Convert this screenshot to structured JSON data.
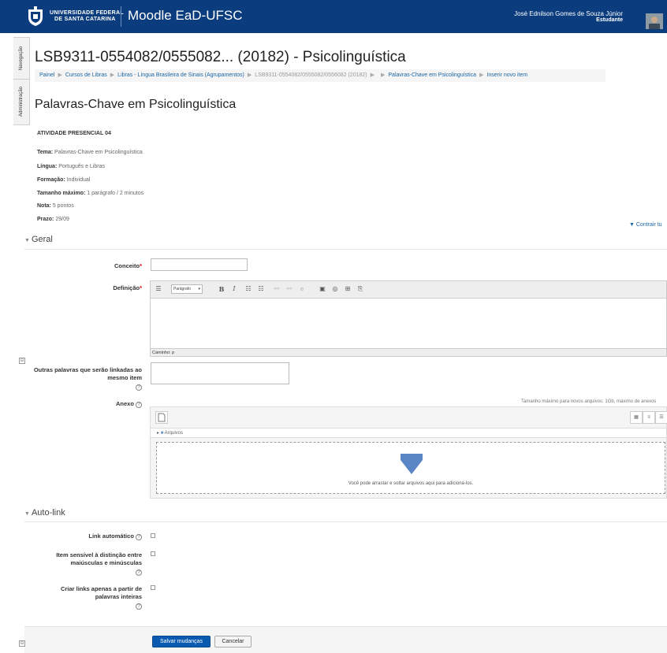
{
  "header": {
    "university": [
      "UNIVERSIDADE FEDERAL",
      "DE SANTA CATARINA"
    ],
    "site_name": "Moodle EaD-UFSC",
    "user_name": "José Ednilson Gomes de Souza Júnior",
    "user_role": "Estudante"
  },
  "dock": {
    "tab1": "Navegação",
    "tab2": "Administração"
  },
  "course_title": "LSB9311-0554082/0555082... (20182) - Psicolinguística",
  "breadcrumb": {
    "items": [
      "Painel",
      "Cursos de Libras",
      "Libras - Língua Brasileira de Sinais (Agrupamentos)",
      "LSB9311-0554082/0555082/0556082 (20182)",
      "",
      "Palavras-Chave em Psicolinguística",
      "Inserir novo item"
    ]
  },
  "page_title": "Palavras-Chave em Psicolinguística",
  "description": {
    "heading": "ATIVIDADE PRESENCIAL 04",
    "rows": [
      {
        "label": "Tema:",
        "value": " Palavras-Chave em Psicolinguística"
      },
      {
        "label": "Língua:",
        "value": " Português e Libras"
      },
      {
        "label": "Formação:",
        "value": " Individual"
      },
      {
        "label": "Tamanho máximo:",
        "value": " 1 parágrafo / 2 minutos"
      },
      {
        "label": "Nota:",
        "value": " 5 pontos"
      },
      {
        "label": "Prazo:",
        "value": " 29/09"
      }
    ]
  },
  "collapse_all": "Contrair tu",
  "general": {
    "title": "Geral",
    "concept_label": "Conceito",
    "definition_label": "Definição",
    "editor_format": "Parágrafo",
    "editor_path": "Caminho: p",
    "aliases_label": "Outras palavras que serão linkadas ao mesmo item",
    "attachment_label": "Anexo",
    "max_files_info": "Tamanho máximo para novos arquivos: 1Gb, máximo de anexos",
    "files_folder": "Arquivos",
    "drop_text": "Você pode arrastar e soltar arquivos aqui para adicioná-los."
  },
  "autolink": {
    "title": "Auto-link",
    "link_label": "Link automático",
    "case_label": "Item sensível à distinção entre maiúsculas e minúsculas",
    "whole_label": "Criar links apenas a partir de palavras inteiras"
  },
  "buttons": {
    "save": "Salvar mudanças",
    "cancel": "Cancelar"
  },
  "colors": {
    "navbar": "#0b3d7e",
    "link": "#1a65a6",
    "primary_button": "#0a5baf"
  }
}
